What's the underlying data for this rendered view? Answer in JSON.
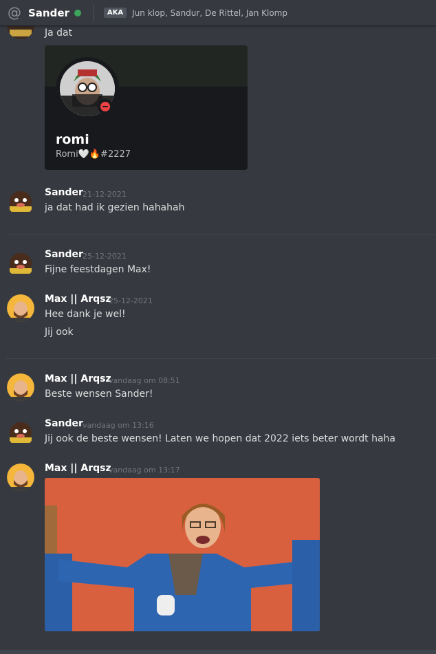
{
  "header": {
    "username": "Sander",
    "aka_label": "AKA",
    "aka_names": "Jun klop, Sandur, De Rittel, Jan Klomp"
  },
  "messages": {
    "m0_text": "Ja dat",
    "card": {
      "name": "romi",
      "tag": "Romi🤍🔥#2227"
    },
    "m1": {
      "user": "Sander",
      "time": "21-12-2021",
      "text": "ja dat had ik gezien hahahah"
    },
    "m2": {
      "user": "Sander",
      "time": "25-12-2021",
      "text": "Fijne feestdagen Max!"
    },
    "m3": {
      "user": "Max || Arqsz",
      "time": "25-12-2021",
      "text": "Hee dank je wel!",
      "text2": "Jij ook"
    },
    "m4": {
      "user": "Max || Arqsz",
      "time": "vandaag om 08:51",
      "text": "Beste wensen Sander!"
    },
    "m5": {
      "user": "Sander",
      "time": "vandaag om 13:16",
      "text": "Jij ook de beste wensen! Laten we hopen dat 2022 iets beter wordt haha"
    },
    "m6": {
      "user": "Max || Arqsz",
      "time": "vandaag om 13:17"
    }
  },
  "colors": {
    "background": "#36393f",
    "online": "#3ba55c",
    "dnd": "#ed4245",
    "gif_bg": "#d8603e"
  }
}
